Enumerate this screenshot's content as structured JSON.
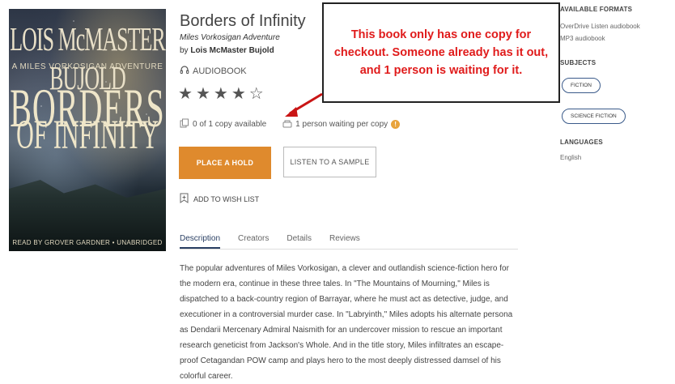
{
  "cover": {
    "author": "LOIS McMASTER BUJOLD",
    "series": "A MILES VORKOSIGAN ADVENTURE",
    "title_line1": "BORDERS",
    "title_line2": "OF INFINITY",
    "reader": "READ BY GROVER GARDNER • UNABRIDGED"
  },
  "book": {
    "title": "Borders of Infinity",
    "series": "Miles Vorkosigan Adventure",
    "by_prefix": "by",
    "author": "Lois McMaster Bujold",
    "format": "AUDIOBOOK",
    "rating": 4,
    "rating_max": 5
  },
  "availability": {
    "copies": "0 of 1 copy available",
    "waiting": "1 person waiting per copy"
  },
  "buttons": {
    "hold": "PLACE A HOLD",
    "sample": "LISTEN TO A SAMPLE",
    "wishlist": "ADD TO WISH LIST"
  },
  "tabs": [
    {
      "label": "Description",
      "active": true
    },
    {
      "label": "Creators",
      "active": false
    },
    {
      "label": "Details",
      "active": false
    },
    {
      "label": "Reviews",
      "active": false
    }
  ],
  "description": "The popular adventures of Miles Vorkosigan, a clever and outlandish science-fiction hero for the modern era, continue in these three tales. In \"The Mountains of Mourning,\" Miles is dispatched to a back-country region of Barrayar, where he must act as detective, judge, and executioner in a controversial murder case. In \"Labryinth,\" Miles adopts his alternate persona as Dendarii Mercenary Admiral Naismith for an undercover mission to rescue an important research geneticist from Jackson's Whole. And in the title story, Miles infiltrates an escape-proof Cetagandan POW camp and plays hero to the most deeply distressed damsel of his colorful career.",
  "sidebar": {
    "formats_heading": "AVAILABLE FORMATS",
    "formats": [
      "OverDrive Listen audiobook",
      "MP3 audiobook"
    ],
    "subjects_heading": "SUBJECTS",
    "subjects": [
      "FICTION",
      "SCIENCE FICTION"
    ],
    "languages_heading": "LANGUAGES",
    "languages": [
      "English"
    ]
  },
  "callout": {
    "text": "This book only has one copy for checkout. Someone already has it out, and 1 person is waiting for it."
  },
  "colors": {
    "accent": "#df8a2d",
    "callout_text": "#e01b1b",
    "tab_active": "#2a3f63"
  }
}
